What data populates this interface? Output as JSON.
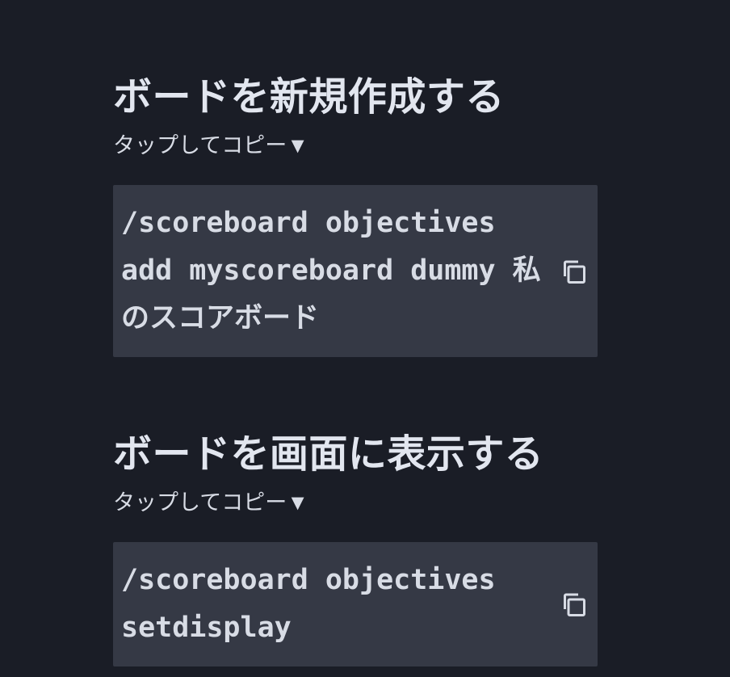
{
  "sections": [
    {
      "title": "ボードを新規作成する",
      "subtitle": "タップしてコピー▼",
      "code": "/scoreboard objectives add myscoreboard dummy 私のスコアボード"
    },
    {
      "title": "ボードを画面に表示する",
      "subtitle": "タップしてコピー▼",
      "code": "/scoreboard objectives setdisplay"
    }
  ]
}
